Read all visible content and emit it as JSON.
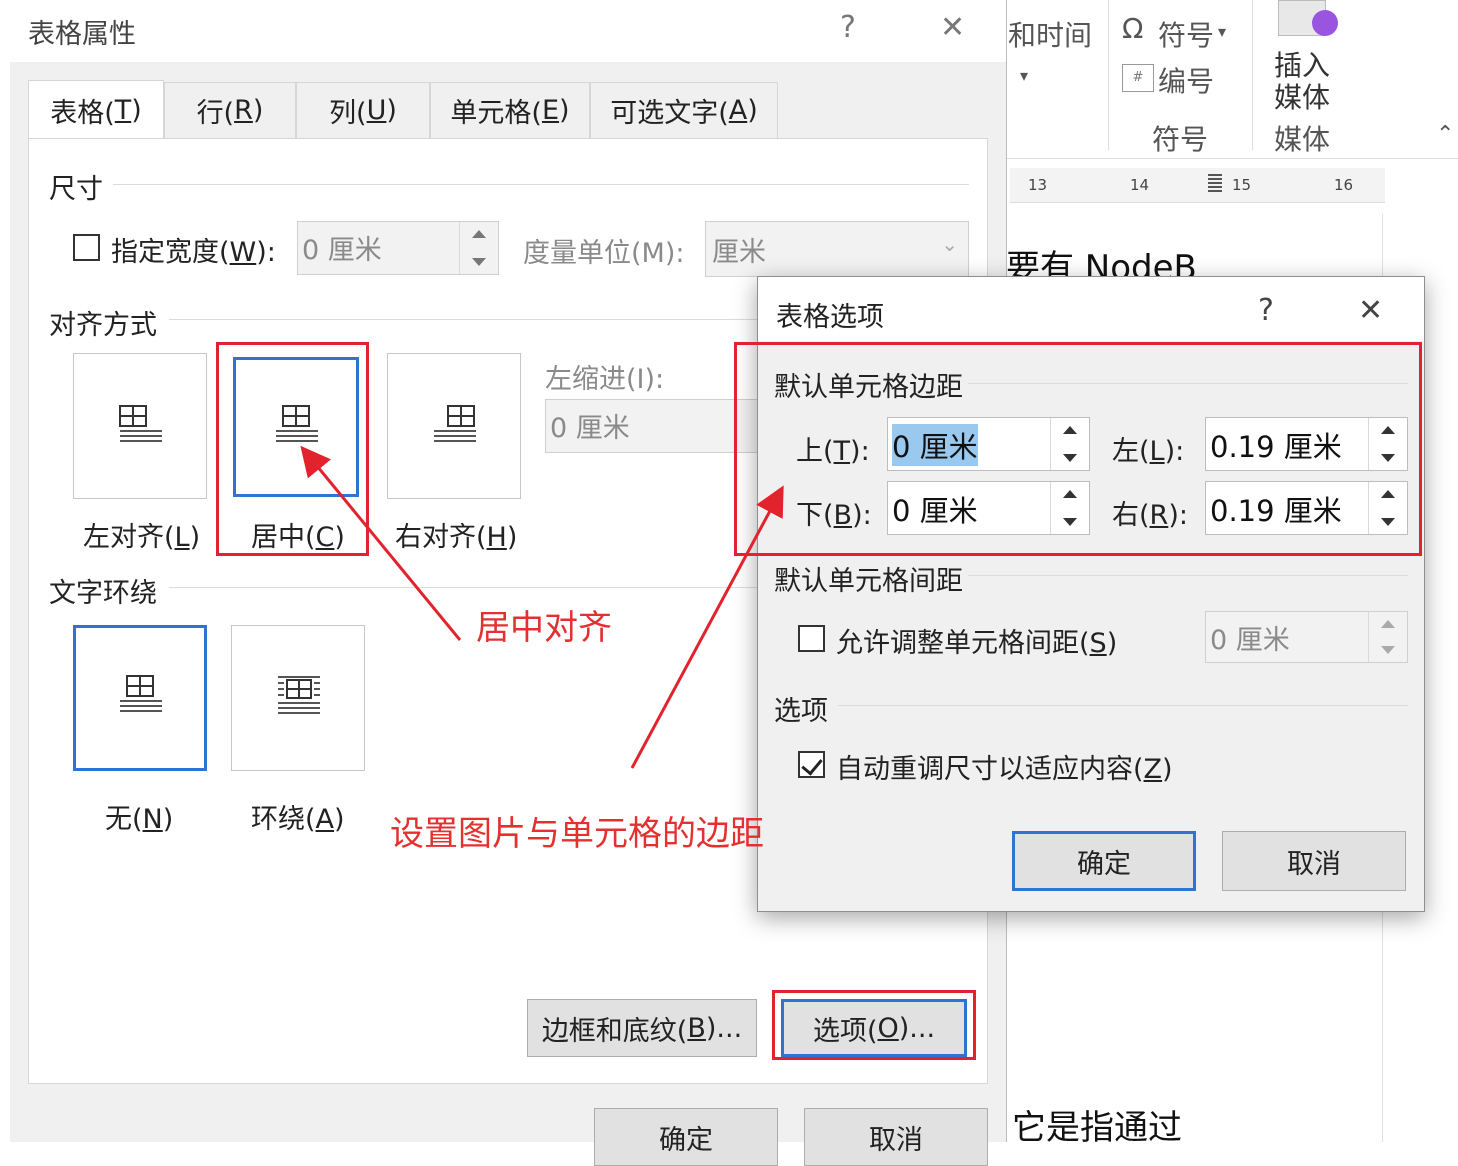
{
  "background": {
    "ribbon": {
      "date_time": "和时间",
      "symbol": "符号",
      "number": "编号",
      "symbol_group": "符号",
      "insert_media_line1": "插入",
      "insert_media_line2": "媒体",
      "media_group": "媒体"
    },
    "ruler": [
      "13",
      "14",
      "15",
      "16"
    ],
    "doc_lines": [
      "要有 NodeB",
      "它是指通过"
    ]
  },
  "table_props": {
    "title": "表格属性",
    "help": "?",
    "close": "✕",
    "tabs": [
      {
        "pre": "表格(",
        "key": "T",
        "post": ")"
      },
      {
        "pre": "行(",
        "key": "R",
        "post": ")"
      },
      {
        "pre": "列(",
        "key": "U",
        "post": ")"
      },
      {
        "pre": "单元格(",
        "key": "E",
        "post": ")"
      },
      {
        "pre": "可选文字(",
        "key": "A",
        "post": ")"
      }
    ],
    "size_section": "尺寸",
    "width_checkbox": {
      "pre": "指定宽度(",
      "key": "W",
      "post": "):"
    },
    "width_value": "0 厘米",
    "unit_label": "度量单位(M):",
    "unit_value": "厘米",
    "align_section": "对齐方式",
    "align_options": [
      {
        "pre": "左对齐(",
        "key": "L",
        "post": ")"
      },
      {
        "pre": "居中(",
        "key": "C",
        "post": ")"
      },
      {
        "pre": "右对齐(",
        "key": "H",
        "post": ")"
      }
    ],
    "indent_label": "左缩进(I):",
    "indent_value": "0 厘米",
    "wrap_section": "文字环绕",
    "wrap_options": [
      {
        "pre": "无(",
        "key": "N",
        "post": ")"
      },
      {
        "pre": "环绕(",
        "key": "A",
        "post": ")"
      }
    ],
    "borders_button": {
      "pre": "边框和底纹(",
      "key": "B",
      "post": ")..."
    },
    "options_button": {
      "pre": "选项(",
      "key": "O",
      "post": ")..."
    },
    "ok": "确定",
    "cancel": "取消"
  },
  "annotations": {
    "center_align": "居中对齐",
    "set_margin": "设置图片与单元格的边距"
  },
  "table_options": {
    "title": "表格选项",
    "help": "?",
    "close": "✕",
    "margin_section": "默认单元格边距",
    "top_label": {
      "pre": "上(",
      "key": "T",
      "post": "):"
    },
    "top_value": "0 厘米",
    "left_label": {
      "pre": "左(",
      "key": "L",
      "post": "):"
    },
    "left_value": "0.19 厘米",
    "bottom_label": {
      "pre": "下(",
      "key": "B",
      "post": "):"
    },
    "bottom_value": "0 厘米",
    "right_label": {
      "pre": "右(",
      "key": "R",
      "post": "):"
    },
    "right_value": "0.19 厘米",
    "spacing_section": "默认单元格间距",
    "spacing_checkbox": {
      "pre": "允许调整单元格间距(",
      "key": "S",
      "post": ")"
    },
    "spacing_value": "0 厘米",
    "options_section": "选项",
    "autofit_checkbox": {
      "pre": "自动重调尺寸以适应内容(",
      "key": "Z",
      "post": ")"
    },
    "ok": "确定",
    "cancel": "取消"
  },
  "colors": {
    "highlight_red": "#e2222c",
    "focus_blue": "#2f74d0",
    "annotation_red": "#e53030"
  }
}
